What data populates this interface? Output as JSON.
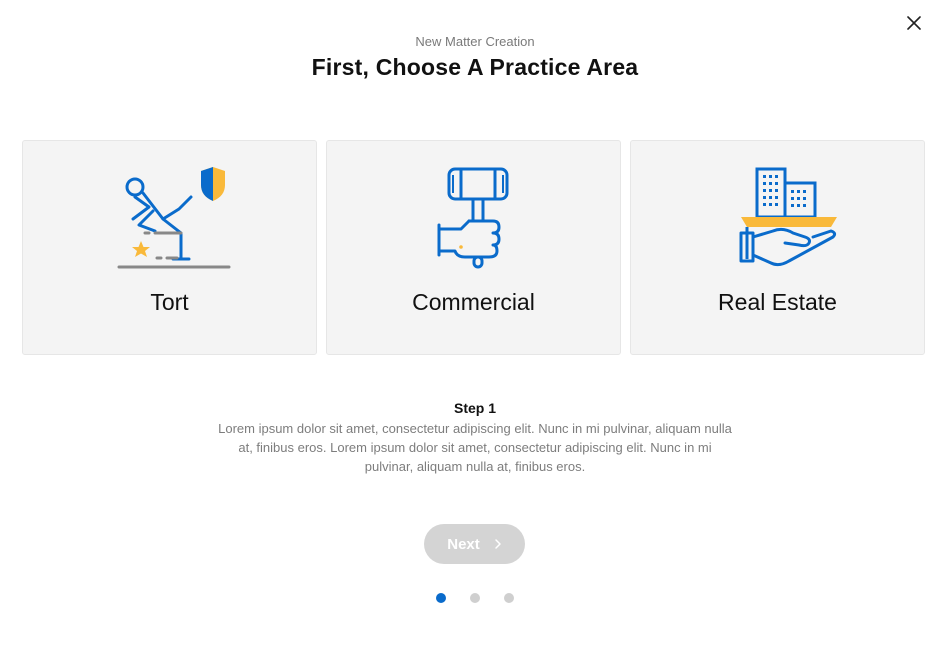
{
  "header": {
    "subtitle": "New Matter Creation",
    "title": "First, Choose A Practice Area"
  },
  "cards": [
    {
      "label": "Tort",
      "icon": "person-slipping-icon"
    },
    {
      "label": "Commercial",
      "icon": "hand-gavel-icon"
    },
    {
      "label": "Real Estate",
      "icon": "hand-buildings-icon"
    }
  ],
  "step": {
    "title": "Step 1",
    "description": "Lorem ipsum dolor sit amet, consectetur adipiscing elit. Nunc in mi pulvinar, aliquam nulla at, finibus eros. Lorem ipsum dolor sit amet, consectetur adipiscing elit. Nunc in mi pulvinar, aliquam nulla at, finibus eros."
  },
  "next_button": {
    "label": "Next"
  },
  "pagination": {
    "total": 3,
    "current": 1
  },
  "colors": {
    "accent": "#0a6bcb",
    "highlight": "#f9b93a",
    "card_bg": "#f4f4f4",
    "button_disabled": "#d4d4d4"
  }
}
